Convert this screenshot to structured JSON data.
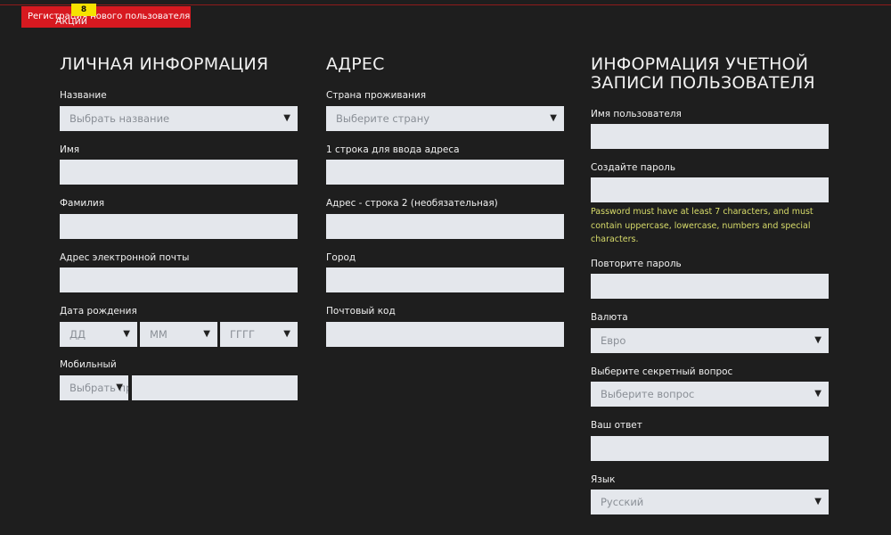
{
  "header": {
    "registration_tab": "Регистрация нового пользователя",
    "promo_label": "Акции",
    "promo_badge": "8"
  },
  "personal": {
    "heading": "ЛИЧНАЯ ИНФОРМАЦИЯ",
    "title_label": "Название",
    "title_placeholder": "Выбрать название",
    "first_name_label": "Имя",
    "last_name_label": "Фамилия",
    "email_label": "Адрес электронной почты",
    "dob_label": "Дата рождения",
    "dob_day": "ДД",
    "dob_month": "ММ",
    "dob_year": "ГГГГ",
    "mobile_label": "Мобильный",
    "mobile_code_placeholder": "Выбрать пр"
  },
  "address": {
    "heading": "АДРЕС",
    "country_label": "Страна проживания",
    "country_placeholder": "Выберите страну",
    "line1_label": "1 строка для ввода адреса",
    "line2_label": "Адрес - строка 2 (необязательная)",
    "city_label": "Город",
    "postcode_label": "Почтовый код"
  },
  "account": {
    "heading_line1": "ИНФОРМАЦИЯ УЧЕТНОЙ",
    "heading_line2": "ЗАПИСИ ПОЛЬЗОВАТЕЛЯ",
    "username_label": "Имя пользователя",
    "password_label": "Создайте пароль",
    "password_hint_1": "Password must have at least 7 characters, and must",
    "password_hint_2": "contain uppercase, lowercase, numbers and special",
    "password_hint_3": "characters.",
    "repeat_password_label": "Повторите пароль",
    "currency_label": "Валюта",
    "currency_value": "Евро",
    "secret_question_label": "Выберите секретный вопрос",
    "secret_question_placeholder": "Выберите вопрос",
    "answer_label": "Ваш ответ",
    "language_label": "Язык",
    "language_value": "Русский"
  },
  "icons": {
    "dropdown": "▼"
  }
}
